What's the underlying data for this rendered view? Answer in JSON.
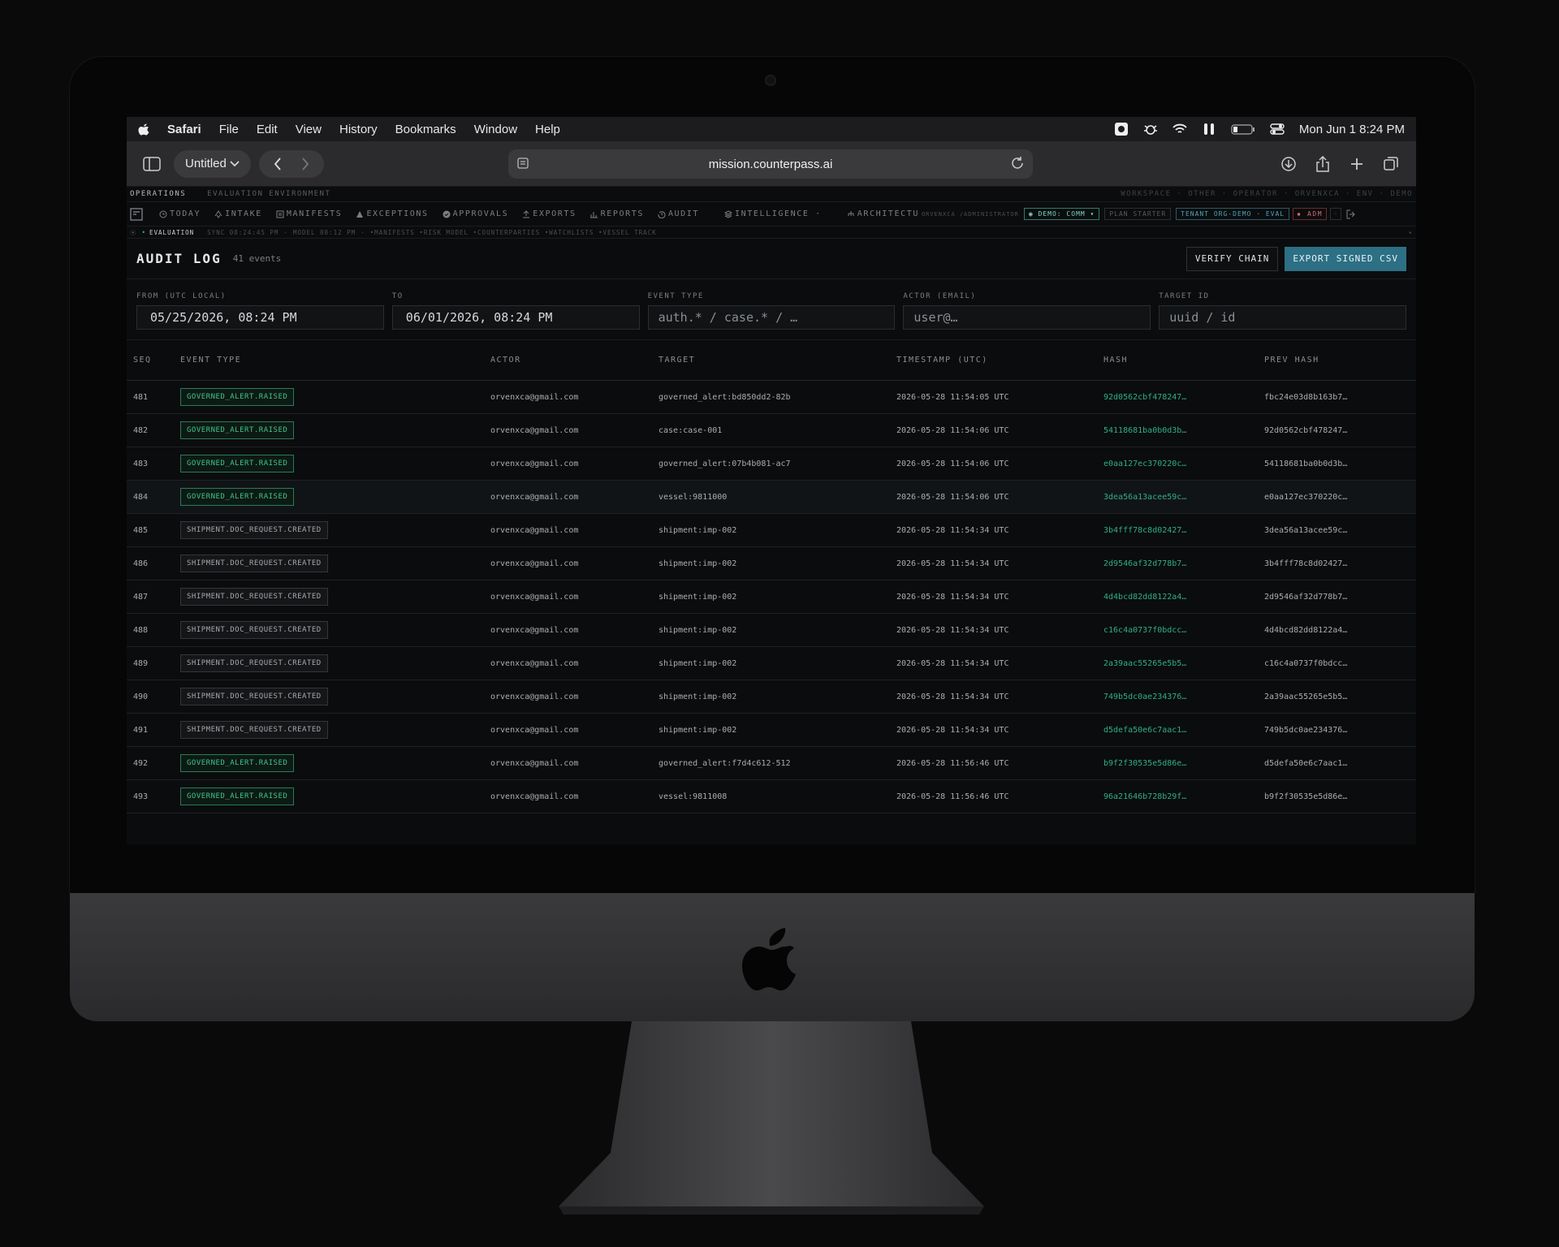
{
  "menubar": {
    "app": "Safari",
    "items": [
      "File",
      "Edit",
      "View",
      "History",
      "Bookmarks",
      "Window",
      "Help"
    ],
    "clock": "Mon Jun 1  8:24 PM"
  },
  "toolbar": {
    "tab_title": "Untitled",
    "url": "mission.counterpass.ai"
  },
  "envbar": {
    "section": "OPERATIONS",
    "environment": "EVALUATION ENVIRONMENT",
    "right": "WORKSPACE · OTHER  ·  OPERATOR · ORVENXCA  ·  ENV · DEMO"
  },
  "nav": {
    "items": [
      {
        "label": "TODAY",
        "icon": "clock-icon"
      },
      {
        "label": "INTAKE",
        "icon": "intake-icon"
      },
      {
        "label": "MANIFESTS",
        "icon": "manifest-icon"
      },
      {
        "label": "EXCEPTIONS",
        "icon": "warning-icon"
      },
      {
        "label": "APPROVALS",
        "icon": "check-circle-icon"
      },
      {
        "label": "EXPORTS",
        "icon": "upload-icon"
      },
      {
        "label": "REPORTS",
        "icon": "chart-icon"
      },
      {
        "label": "AUDIT",
        "icon": "history-icon"
      },
      {
        "label": "INTELLIGENCE ·",
        "icon": "layers-icon"
      },
      {
        "label": "ARCHITECTU",
        "icon": "hierarchy-icon"
      }
    ],
    "user": "ORVENXCA /ADMINISTRATOR",
    "demo_badge": "DEMO: COMM",
    "plan_badge": "PLAN STARTER",
    "tenant_badge": "TENANT ORG-DEMO · EVAL",
    "adm_badge": "ADM"
  },
  "statusbar": {
    "mode": "EVALUATION",
    "sync": "SYNC 08:24:45 PM",
    "model": "MODEL 08:12 PM",
    "tags": "•MANIFESTS •RISK MODEL •COUNTERPARTIES •WATCHLISTS •VESSEL TRACK"
  },
  "header": {
    "title": "AUDIT LOG",
    "count": "41 events",
    "verify_label": "VERIFY CHAIN",
    "export_label": "EXPORT SIGNED CSV"
  },
  "filters": {
    "from_label": "FROM (UTC LOCAL)",
    "from_value": "05/25/2026, 08:24 PM",
    "to_label": "TO",
    "to_value": "06/01/2026, 08:24 PM",
    "type_label": "EVENT TYPE",
    "type_placeholder": "auth.* / case.* / …",
    "actor_label": "ACTOR (EMAIL)",
    "actor_placeholder": "user@…",
    "target_label": "TARGET ID",
    "target_placeholder": "uuid / id"
  },
  "table": {
    "columns": [
      "SEQ",
      "EVENT TYPE",
      "ACTOR",
      "TARGET",
      "TIMESTAMP (UTC)",
      "HASH",
      "PREV HASH"
    ],
    "rows": [
      {
        "seq": "481",
        "type": "GOVERNED_ALERT.RAISED",
        "kind": "alert",
        "actor": "orvenxca@gmail.com",
        "target": "governed_alert:bd850dd2-82b",
        "ts": "2026-05-28 11:54:05 UTC",
        "hash": "92d0562cbf478247…",
        "prev": "fbc24e03d8b163b7…"
      },
      {
        "seq": "482",
        "type": "GOVERNED_ALERT.RAISED",
        "kind": "alert",
        "actor": "orvenxca@gmail.com",
        "target": "case:case-001",
        "ts": "2026-05-28 11:54:06 UTC",
        "hash": "54118681ba0b0d3b…",
        "prev": "92d0562cbf478247…"
      },
      {
        "seq": "483",
        "type": "GOVERNED_ALERT.RAISED",
        "kind": "alert",
        "actor": "orvenxca@gmail.com",
        "target": "governed_alert:07b4b081-ac7",
        "ts": "2026-05-28 11:54:06 UTC",
        "hash": "e0aa127ec370220c…",
        "prev": "54118681ba0b0d3b…"
      },
      {
        "seq": "484",
        "type": "GOVERNED_ALERT.RAISED",
        "kind": "alert",
        "actor": "orvenxca@gmail.com",
        "target": "vessel:9811000",
        "ts": "2026-05-28 11:54:06 UTC",
        "hash": "3dea56a13acee59c…",
        "prev": "e0aa127ec370220c…"
      },
      {
        "seq": "485",
        "type": "SHIPMENT.DOC_REQUEST.CREATED",
        "kind": "doc",
        "actor": "orvenxca@gmail.com",
        "target": "shipment:imp-002",
        "ts": "2026-05-28 11:54:34 UTC",
        "hash": "3b4fff78c8d02427…",
        "prev": "3dea56a13acee59c…"
      },
      {
        "seq": "486",
        "type": "SHIPMENT.DOC_REQUEST.CREATED",
        "kind": "doc",
        "actor": "orvenxca@gmail.com",
        "target": "shipment:imp-002",
        "ts": "2026-05-28 11:54:34 UTC",
        "hash": "2d9546af32d778b7…",
        "prev": "3b4fff78c8d02427…"
      },
      {
        "seq": "487",
        "type": "SHIPMENT.DOC_REQUEST.CREATED",
        "kind": "doc",
        "actor": "orvenxca@gmail.com",
        "target": "shipment:imp-002",
        "ts": "2026-05-28 11:54:34 UTC",
        "hash": "4d4bcd82dd8122a4…",
        "prev": "2d9546af32d778b7…"
      },
      {
        "seq": "488",
        "type": "SHIPMENT.DOC_REQUEST.CREATED",
        "kind": "doc",
        "actor": "orvenxca@gmail.com",
        "target": "shipment:imp-002",
        "ts": "2026-05-28 11:54:34 UTC",
        "hash": "c16c4a0737f0bdcc…",
        "prev": "4d4bcd82dd8122a4…"
      },
      {
        "seq": "489",
        "type": "SHIPMENT.DOC_REQUEST.CREATED",
        "kind": "doc",
        "actor": "orvenxca@gmail.com",
        "target": "shipment:imp-002",
        "ts": "2026-05-28 11:54:34 UTC",
        "hash": "2a39aac55265e5b5…",
        "prev": "c16c4a0737f0bdcc…"
      },
      {
        "seq": "490",
        "type": "SHIPMENT.DOC_REQUEST.CREATED",
        "kind": "doc",
        "actor": "orvenxca@gmail.com",
        "target": "shipment:imp-002",
        "ts": "2026-05-28 11:54:34 UTC",
        "hash": "749b5dc0ae234376…",
        "prev": "2a39aac55265e5b5…"
      },
      {
        "seq": "491",
        "type": "SHIPMENT.DOC_REQUEST.CREATED",
        "kind": "doc",
        "actor": "orvenxca@gmail.com",
        "target": "shipment:imp-002",
        "ts": "2026-05-28 11:54:34 UTC",
        "hash": "d5defa50e6c7aac1…",
        "prev": "749b5dc0ae234376…"
      },
      {
        "seq": "492",
        "type": "GOVERNED_ALERT.RAISED",
        "kind": "alert",
        "actor": "orvenxca@gmail.com",
        "target": "governed_alert:f7d4c612-512",
        "ts": "2026-05-28 11:56:46 UTC",
        "hash": "b9f2f30535e5d86e…",
        "prev": "d5defa50e6c7aac1…"
      },
      {
        "seq": "493",
        "type": "GOVERNED_ALERT.RAISED",
        "kind": "alert",
        "actor": "orvenxca@gmail.com",
        "target": "vessel:9811008",
        "ts": "2026-05-28 11:56:46 UTC",
        "hash": "96a21646b728b29f…",
        "prev": "b9f2f30535e5d86e…"
      }
    ]
  },
  "colors": {
    "accent": "#2d6f84",
    "hash_green": "#2fae8a",
    "alert_green": "#3ec48f"
  }
}
